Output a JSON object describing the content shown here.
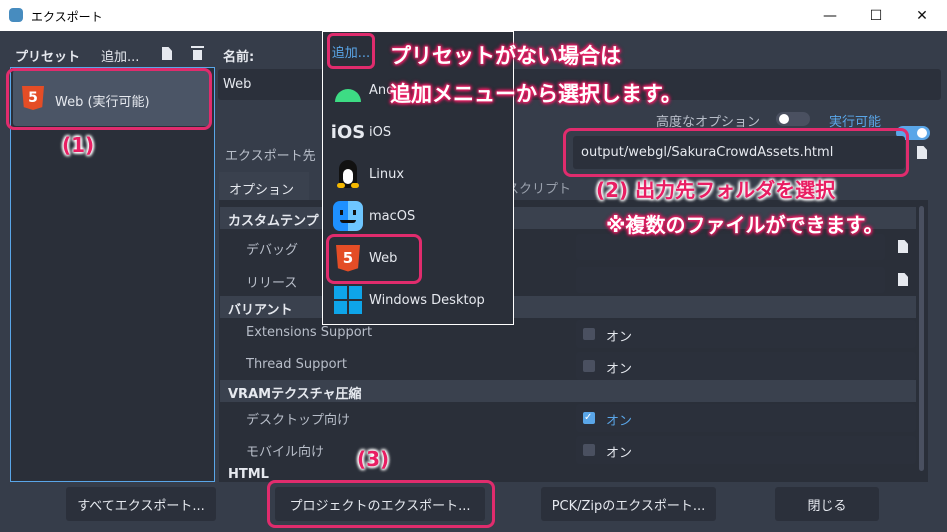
{
  "window": {
    "title": "エクスポート",
    "min_glyph": "—",
    "max_glyph": "☐",
    "close_glyph": "✕"
  },
  "left": {
    "presets_label": "プリセット",
    "add_label": "追加...",
    "selected_preset": "Web (実行可能)"
  },
  "right": {
    "name_label": "名前:",
    "name_value": "Web",
    "advanced_label": "高度なオプション",
    "runnable_label": "実行可能",
    "export_path_label": "エクスポート先",
    "export_path_value": "output/webgl/SakuraCrowdAssets.html",
    "tabs": [
      "オプション",
      "スクリプト"
    ],
    "options": [
      {
        "kind": "section",
        "label": "カスタムテンプ"
      },
      {
        "kind": "row",
        "label": "デバッグ"
      },
      {
        "kind": "row",
        "label": "リリース"
      },
      {
        "kind": "section",
        "label": "バリアント"
      },
      {
        "kind": "row",
        "label": "Extensions Support",
        "value": "オン",
        "checked": false
      },
      {
        "kind": "row",
        "label": "Thread Support",
        "value": "オン",
        "checked": false
      },
      {
        "kind": "section",
        "label": "VRAMテクスチャ圧縮"
      },
      {
        "kind": "row",
        "label": "デスクトップ向け",
        "value": "オン",
        "checked": true
      },
      {
        "kind": "row",
        "label": "モバイル向け",
        "value": "オン",
        "checked": false
      },
      {
        "kind": "section",
        "label": "HTML"
      }
    ],
    "peek_texts": [
      "ム",
      "ッ",
      "ー",
      "ン",
      "ポ"
    ]
  },
  "dropdown": {
    "add_button": "追加...",
    "items": [
      {
        "label": "Android",
        "icon": "android-icon"
      },
      {
        "label": "iOS",
        "icon": "ios-icon",
        "icon_text": "iOS"
      },
      {
        "label": "Linux",
        "icon": "linux-icon"
      },
      {
        "label": "macOS",
        "icon": "macos-icon"
      },
      {
        "label": "Web",
        "icon": "html5-icon"
      },
      {
        "label": "Windows Desktop",
        "icon": "windows-icon"
      }
    ],
    "html5_glyph": "5"
  },
  "footer": {
    "export_all": "すべてエクスポート...",
    "export_project": "プロジェクトのエクスポート...",
    "export_pck": "PCK/Zipのエクスポート...",
    "close": "閉じる"
  },
  "annotations": {
    "a1": "(1)",
    "a2": "(2) 出力先フォルダを選択",
    "a2_note": "※複数のファイルができます。",
    "a3": "(3)",
    "top_line1": "プリセットがない場合は",
    "top_line2": "追加メニューから選択します。"
  },
  "colors": {
    "accent": "#5aa6e8",
    "highlight": "#e02c6d",
    "html5": "#e44d26",
    "android": "#3ddc84"
  }
}
